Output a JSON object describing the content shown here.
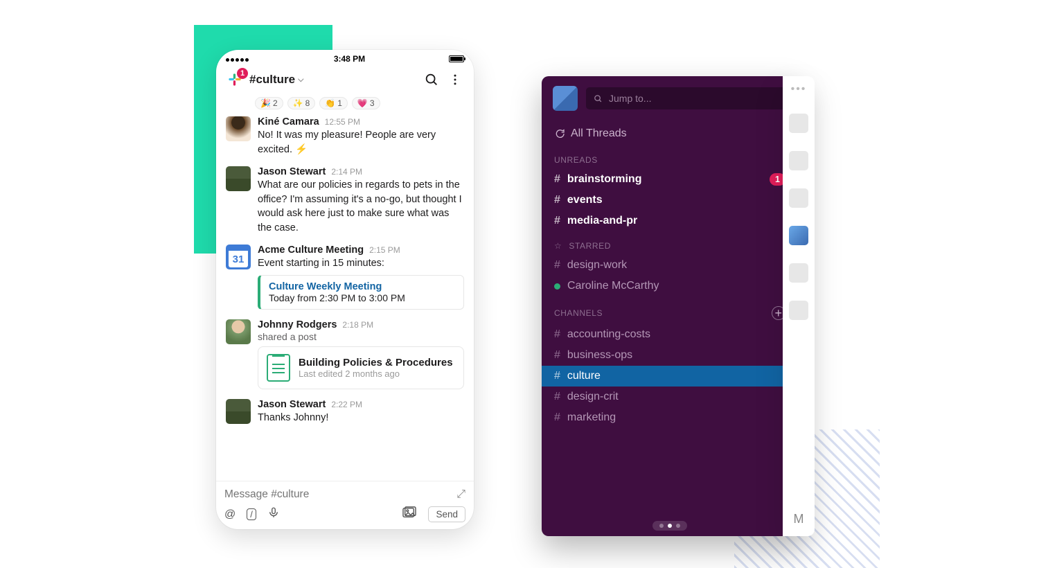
{
  "statusbar": {
    "time": "3:48 PM"
  },
  "header": {
    "channel": "#culture",
    "notification_badge": "1"
  },
  "reactions": [
    {
      "emoji": "🎉",
      "count": "2"
    },
    {
      "emoji": "✨",
      "count": "8"
    },
    {
      "emoji": "👏",
      "count": "1"
    },
    {
      "emoji": "💗",
      "count": "3"
    }
  ],
  "messages": {
    "kine": {
      "name": "Kiné Camara",
      "time": "12:55 PM",
      "text": "No! It was my pleasure! People are very excited.  ⚡"
    },
    "jason1": {
      "name": "Jason Stewart",
      "time": "2:14 PM",
      "text": "What are our policies in regards to pets in the office? I'm assuming it's a no-go, but thought I would ask here just to make sure what was the case."
    },
    "cal": {
      "name": "Acme Culture Meeting",
      "time": "2:15 PM",
      "sub": "Event starting in 15 minutes:",
      "day": "31",
      "event_title": "Culture Weekly Meeting",
      "event_sub": "Today from 2:30 PM to 3:00 PM"
    },
    "johnny": {
      "name": "Johnny Rodgers",
      "time": "2:18 PM",
      "sub": "shared a post",
      "file_title": "Building Policies & Procedures",
      "file_sub": "Last edited 2 months ago"
    },
    "jason2": {
      "name": "Jason Stewart",
      "time": "2:22 PM",
      "text": "Thanks Johnny!"
    }
  },
  "composer": {
    "placeholder": "Message #culture",
    "send_label": "Send"
  },
  "sidebar": {
    "jump_placeholder": "Jump to...",
    "all_threads": "All Threads",
    "sections": {
      "unreads_label": "UNREADS",
      "starred_label": "STARRED",
      "channels_label": "CHANNELS"
    },
    "unreads": {
      "brainstorming": {
        "name": "brainstorming",
        "badge": "1"
      },
      "events": {
        "name": "events"
      },
      "media": {
        "name": "media-and-pr"
      }
    },
    "starred": {
      "design_work": "design-work",
      "caroline": "Caroline McCarthy"
    },
    "channels": {
      "accounting": "accounting-costs",
      "business": "business-ops",
      "culture": "culture",
      "designcrit": "design-crit",
      "marketing": "marketing"
    }
  },
  "peek": {
    "initial": "M"
  }
}
